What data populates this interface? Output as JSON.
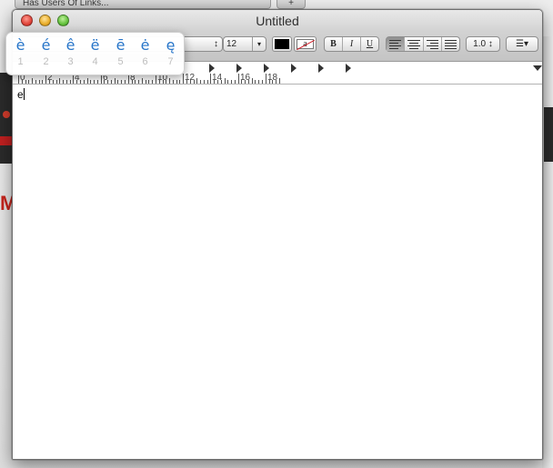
{
  "background": {
    "browser_tab_title": "Has Users Of Links...",
    "new_tab_label": "+"
  },
  "window": {
    "title": "Untitled"
  },
  "toolbar": {
    "font_stepper_arrows": "↕",
    "font_size": "12",
    "font_size_arrow": "▾",
    "text_color": "#000000",
    "highlight_glyph": "a",
    "bold": "B",
    "italic": "I",
    "underline": "U",
    "alignment_options": [
      "align-left",
      "align-center",
      "align-right",
      "justify"
    ],
    "line_spacing": "1.0 ↕",
    "list_menu": "☰▾"
  },
  "ruler": {
    "labels": [
      "0",
      "2",
      "4",
      "6",
      "8",
      "10",
      "12",
      "14",
      "16",
      "18"
    ]
  },
  "document": {
    "text": "e"
  },
  "accent_popup": {
    "options": [
      {
        "char": "è",
        "number": "1"
      },
      {
        "char": "é",
        "number": "2"
      },
      {
        "char": "ê",
        "number": "3"
      },
      {
        "char": "ë",
        "number": "4"
      },
      {
        "char": "ē",
        "number": "5"
      },
      {
        "char": "ė",
        "number": "6"
      },
      {
        "char": "ę",
        "number": "7"
      }
    ],
    "char_color": "#2775c9",
    "number_color": "#bdbdbd"
  }
}
